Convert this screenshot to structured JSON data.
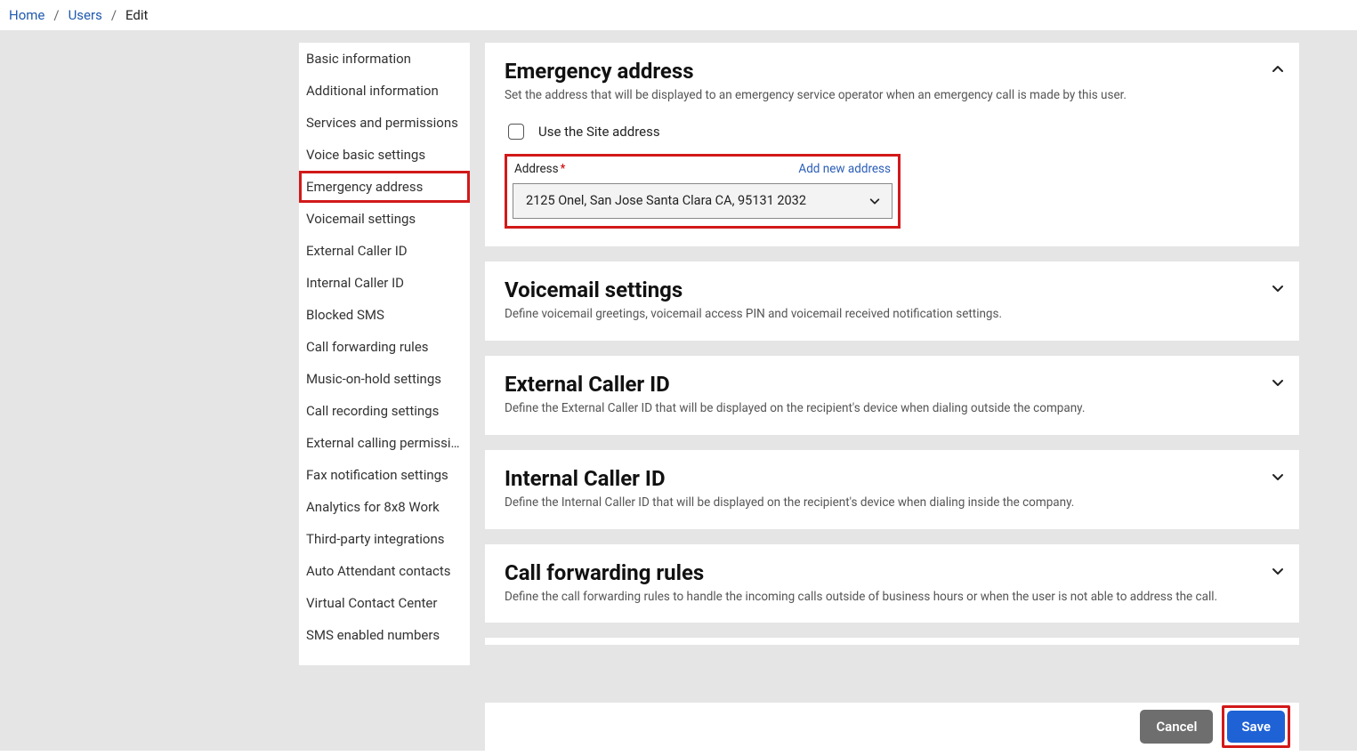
{
  "breadcrumb": {
    "home": "Home",
    "users": "Users",
    "current": "Edit"
  },
  "sidebar": {
    "items": [
      "Basic information",
      "Additional information",
      "Services and permissions",
      "Voice basic settings",
      "Emergency address",
      "Voicemail settings",
      "External Caller ID",
      "Internal Caller ID",
      "Blocked SMS",
      "Call forwarding rules",
      "Music-on-hold settings",
      "Call recording settings",
      "External calling permissions",
      "Fax notification settings",
      "Analytics for 8x8 Work",
      "Third-party integrations",
      "Auto Attendant contacts",
      "Virtual Contact Center",
      "SMS enabled numbers"
    ]
  },
  "emergency": {
    "title": "Emergency address",
    "desc": "Set the address that will be displayed to an emergency service operator when an emergency call is made by this user.",
    "use_site_label": "Use the Site address",
    "address_label": "Address",
    "add_new": "Add new address",
    "selected": "2125 Onel, San Jose Santa Clara CA, 95131 2032"
  },
  "sections": {
    "voicemail": {
      "title": "Voicemail settings",
      "desc": "Define voicemail greetings, voicemail access PIN and voicemail received notification settings."
    },
    "ext_cid": {
      "title": "External Caller ID",
      "desc": "Define the External Caller ID that will be displayed on the recipient's device when dialing outside the company."
    },
    "int_cid": {
      "title": "Internal Caller ID",
      "desc": "Define the Internal Caller ID that will be displayed on the recipient's device when dialing inside the company."
    },
    "fwd": {
      "title": "Call forwarding rules",
      "desc": "Define the call forwarding rules to handle the incoming calls outside of business hours or when the user is not able to address the call."
    }
  },
  "footer": {
    "cancel": "Cancel",
    "save": "Save"
  }
}
